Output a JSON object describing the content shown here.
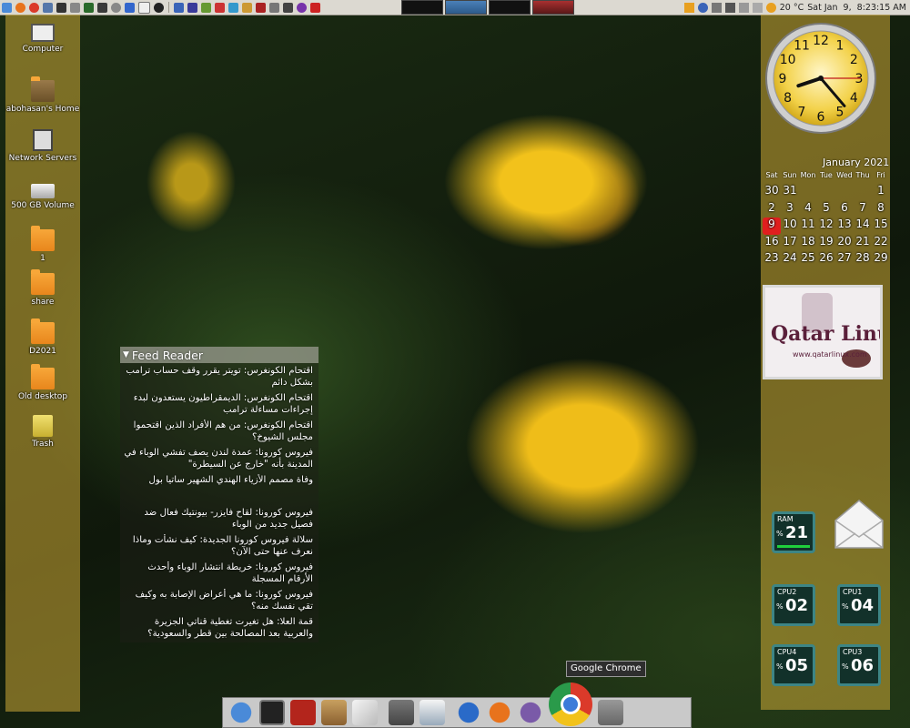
{
  "desktop": {
    "icons": [
      {
        "label": "Computer",
        "glyph": "computer-icon"
      },
      {
        "label": "abohasan's Home",
        "glyph": "home-folder-icon"
      },
      {
        "label": "Network Servers",
        "glyph": "network-servers-icon"
      },
      {
        "label": "500 GB Volume",
        "glyph": "drive-icon"
      },
      {
        "label": "1",
        "glyph": "folder-icon"
      },
      {
        "label": "share",
        "glyph": "shared-folder-icon"
      },
      {
        "label": "D2021",
        "glyph": "folder-icon"
      },
      {
        "label": "Old desktop",
        "glyph": "folder-link-icon"
      },
      {
        "label": "Trash",
        "glyph": "trash-icon"
      }
    ]
  },
  "top_panel": {
    "temperature": "20 °C",
    "datetime": "Sat Jan  9,  8:23:15 AM"
  },
  "calendar": {
    "title": "January 2021",
    "weekdays": [
      "Sat",
      "Sun",
      "Mon",
      "Tue",
      "Wed",
      "Thu",
      "Fri"
    ],
    "rows": [
      [
        "30",
        "31",
        "",
        "",
        "",
        "",
        "1"
      ],
      [
        "2",
        "3",
        "4",
        "5",
        "6",
        "7",
        "8"
      ],
      [
        "9",
        "10",
        "11",
        "12",
        "13",
        "14",
        "15"
      ],
      [
        "16",
        "17",
        "18",
        "19",
        "20",
        "21",
        "22"
      ],
      [
        "23",
        "24",
        "25",
        "26",
        "27",
        "28",
        "29"
      ]
    ],
    "today": "9"
  },
  "clock": {
    "hour": 8,
    "minute": 23,
    "second": 15,
    "numerals": [
      "12",
      "1",
      "2",
      "3",
      "4",
      "5",
      "6",
      "7",
      "8",
      "9",
      "10",
      "11"
    ]
  },
  "meters": [
    {
      "label": "RAM",
      "value": "21",
      "percent_sign": "%"
    },
    {
      "label": "CPU2",
      "value": "02",
      "percent_sign": "%"
    },
    {
      "label": "CPU1",
      "value": "04",
      "percent_sign": "%"
    },
    {
      "label": "CPU4",
      "value": "05",
      "percent_sign": "%"
    },
    {
      "label": "CPU3",
      "value": "06",
      "percent_sign": "%"
    }
  ],
  "feed_reader": {
    "title": "Feed Reader",
    "items": [
      "اقتحام الكونغرس: تويتر يقرر وقف حساب ترامب بشكل دائم",
      "اقتحام الكونغرس: الديمقراطيون يستعدون لبدء إجراءات مساءلة ترامب",
      "اقتحام الكونغرس: من هم الأفراد الذين اقتحموا مجلس الشيوخ؟",
      "فيروس كورونا: عمدة لندن يصف تفشي الوباء في المدينة بأنه \"خارج عن السيطرة\"",
      "وفاة مصمم الأزياء الهندي الشهير ساتيا بول",
      "فيروس كورونا: لقاح فايزر- بيونتيك فعال ضد فصيل جديد من الوباء",
      "سلالة فيروس كورونا الجديدة: كيف نشأت وماذا نعرف عنها حتى الآن؟",
      "فيروس كورونا: خريطة انتشار الوباء وأحدث الأرقام المسجلة",
      "فيروس كورونا: ما هي أعراض الإصابة به وكيف تقي نفسك منه؟",
      "قمة العلا: هل تغيرت تغطية قناتي الجزيرة والعربية بعد المصالحة بين قطر والسعودية؟"
    ]
  },
  "dock": {
    "tooltip": "Google Chrome",
    "apps": [
      "accessibility-icon",
      "terminal-icon",
      "filezilla-icon",
      "package-manager-icon",
      "text-editor-icon",
      "gimp-icon",
      "document-viewer-icon",
      "thunderbird-icon",
      "firefox-icon",
      "pidgin-icon",
      "chrome-icon",
      "archive-icon"
    ]
  },
  "logo": {
    "text": "Qatar Linux",
    "sub": "www.qatarlinux.com"
  }
}
